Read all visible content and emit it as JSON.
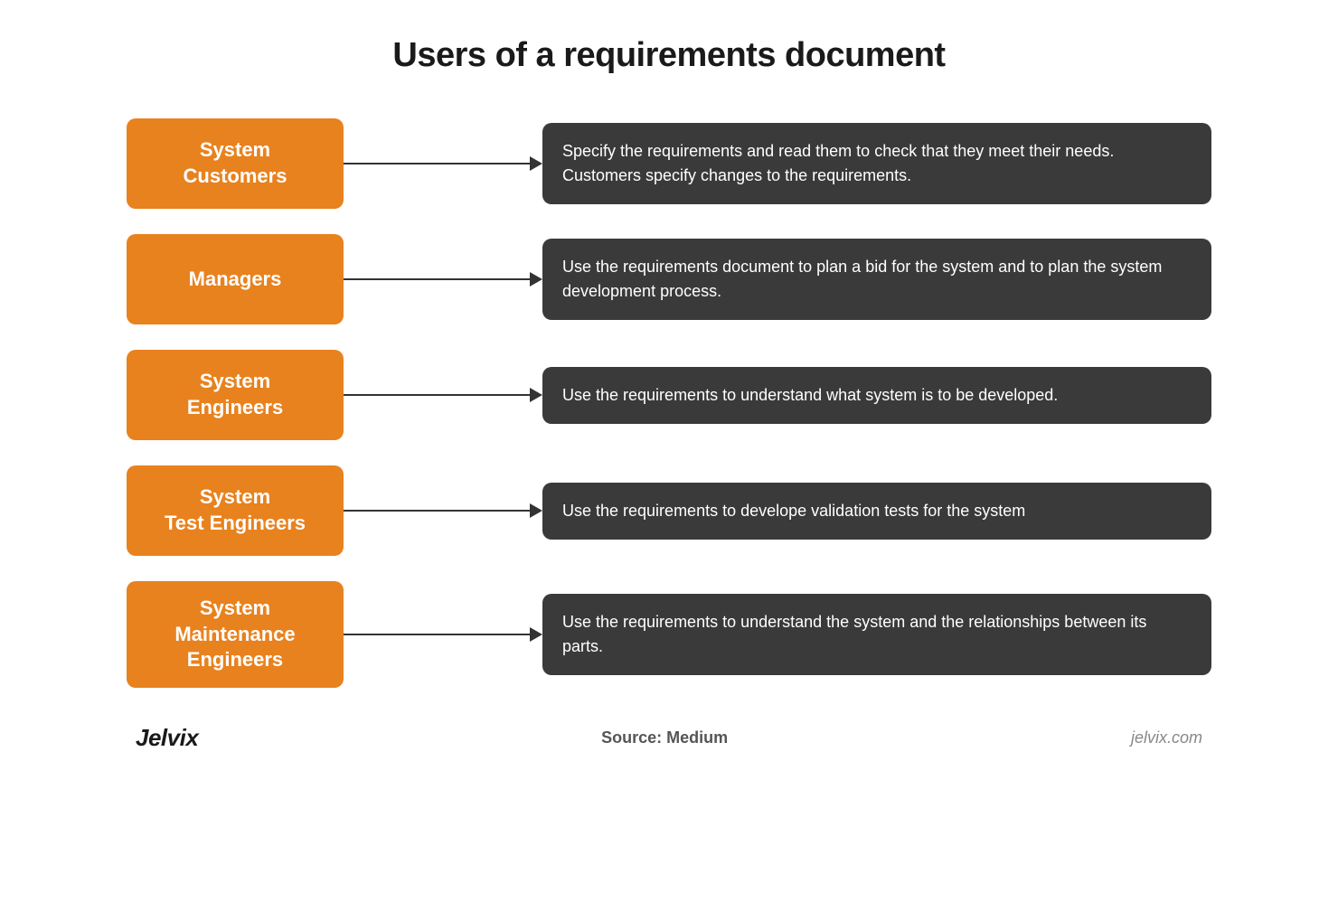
{
  "title": "Users of a requirements document",
  "rows": [
    {
      "id": "customers",
      "label": "System\nCustomers",
      "description": "Specify the requirements and read them to check that they meet their needs. Customers specify changes to the requirements."
    },
    {
      "id": "managers",
      "label": "Managers",
      "description": "Use the requirements document to plan a bid for the system and to plan the system development process."
    },
    {
      "id": "engineers",
      "label": "System\nEngineers",
      "description": "Use the requirements to understand what system is to be developed."
    },
    {
      "id": "test-engineers",
      "label": "System\nTest Engineers",
      "description": "Use the requirements to develope validation tests for the system"
    },
    {
      "id": "maintenance-engineers",
      "label": "System\nMaintenance\nEngineers",
      "description": "Use the requirements to understand the system and the relationships between its parts."
    }
  ],
  "footer": {
    "brand_left": "Jelvix",
    "source_label": "Source:",
    "source_value": "Medium",
    "brand_right": "jelvix.com"
  }
}
